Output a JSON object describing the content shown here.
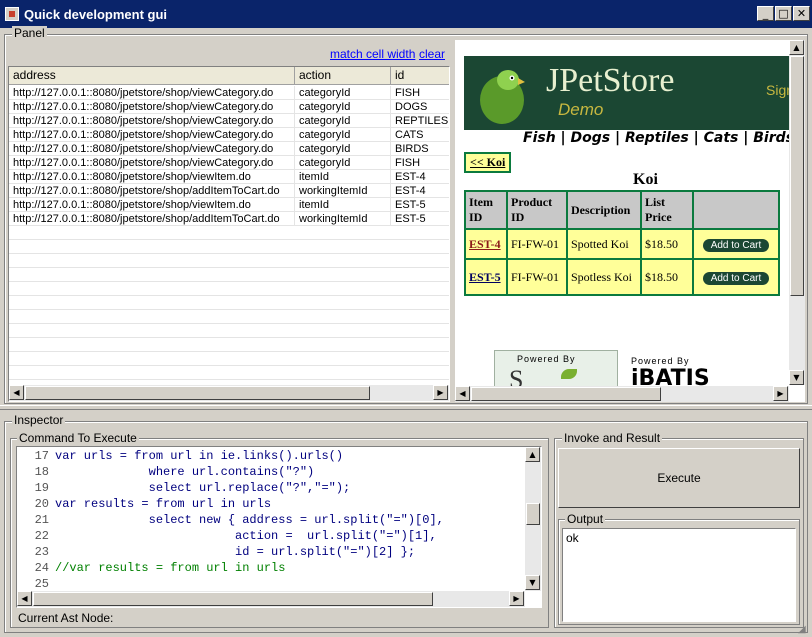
{
  "window": {
    "title": "Quick development gui",
    "min_glyph": "_",
    "max_glyph": "□",
    "close_glyph": "✕"
  },
  "panel": {
    "label": "Panel",
    "match_cell_width": "match cell width",
    "clear": "clear",
    "columns": [
      "address",
      "action",
      "id"
    ],
    "rows": [
      [
        "http://127.0.0.1::8080/jpetstore/shop/viewCategory.do",
        "categoryId",
        "FISH"
      ],
      [
        "http://127.0.0.1::8080/jpetstore/shop/viewCategory.do",
        "categoryId",
        "DOGS"
      ],
      [
        "http://127.0.0.1::8080/jpetstore/shop/viewCategory.do",
        "categoryId",
        "REPTILES"
      ],
      [
        "http://127.0.0.1::8080/jpetstore/shop/viewCategory.do",
        "categoryId",
        "CATS"
      ],
      [
        "http://127.0.0.1::8080/jpetstore/shop/viewCategory.do",
        "categoryId",
        "BIRDS"
      ],
      [
        "http://127.0.0.1::8080/jpetstore/shop/viewCategory.do",
        "categoryId",
        "FISH"
      ],
      [
        "http://127.0.0.1::8080/jpetstore/shop/viewItem.do",
        "itemId",
        "EST-4"
      ],
      [
        "http://127.0.0.1::8080/jpetstore/shop/addItemToCart.do",
        "workingItemId",
        "EST-4"
      ],
      [
        "http://127.0.0.1::8080/jpetstore/shop/viewItem.do",
        "itemId",
        "EST-5"
      ],
      [
        "http://127.0.0.1::8080/jpetstore/shop/addItemToCart.do",
        "workingItemId",
        "EST-5"
      ]
    ]
  },
  "browser": {
    "logo": "JPetStore",
    "demo": "Demo",
    "sign": "Sign",
    "nav": [
      "Fish",
      "Dogs",
      "Reptiles",
      "Cats",
      "Birds"
    ],
    "back_link": "<< Koi",
    "heading": "Koi",
    "table_headers": [
      "Item ID",
      "Product ID",
      "Description",
      "List Price",
      ""
    ],
    "items": [
      {
        "item_id": "EST-4",
        "product_id": "FI-FW-01",
        "description": "Spotted Koi",
        "price": "$18.50",
        "button": "Add to Cart"
      },
      {
        "item_id": "EST-5",
        "product_id": "FI-FW-01",
        "description": "Spotless Koi",
        "price": "$18.50",
        "button": "Add to Cart"
      }
    ],
    "powered_by_1": "Powered By",
    "powered_by_2": "Powered By",
    "ibatis": "iBATIS"
  },
  "inspector": {
    "label": "Inspector",
    "command_label": "Command To Execute",
    "invoke_label": "Invoke and Result",
    "execute": "Execute",
    "output_label": "Output",
    "output_value": "ok",
    "current_ast": "Current Ast Node:",
    "code_lines": [
      {
        "n": "17",
        "t": "var urls = from url in ie.links().urls()"
      },
      {
        "n": "18",
        "t": "             where url.contains(\"?\")"
      },
      {
        "n": "19",
        "t": "             select url.replace(\"?\",\"=\");"
      },
      {
        "n": "20",
        "t": "var results = from url in urls"
      },
      {
        "n": "21",
        "t": "             select new { address = url.split(\"=\")[0],"
      },
      {
        "n": "22",
        "t": "                         action =  url.split(\"=\")[1],"
      },
      {
        "n": "23",
        "t": "                         id = url.split(\"=\")[2] };"
      },
      {
        "n": "24",
        "t": "//var results = from url in urls"
      },
      {
        "n": "25",
        "t": ""
      }
    ]
  },
  "colors": {
    "titlebar": "#0a246a",
    "petstore_green": "#0b7a3e",
    "link_blue": "#0000ff"
  }
}
